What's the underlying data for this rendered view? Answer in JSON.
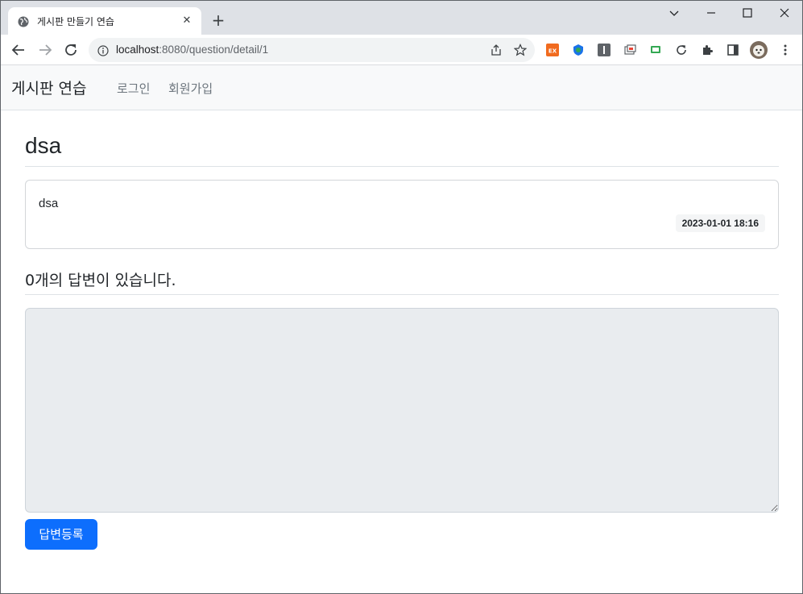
{
  "browser": {
    "tab_title": "게시판 만들기 연습",
    "tab_close": "✕",
    "new_tab": "+",
    "url_host": "localhost",
    "url_rest": ":8080/question/detail/1"
  },
  "navbar": {
    "brand": "게시판 연습",
    "links": [
      "로그인",
      "회원가입"
    ]
  },
  "question": {
    "subject": "dsa",
    "content": "dsa",
    "create_date": "2023-01-01 18:16"
  },
  "answers": {
    "count_text": "0개의 답변이 있습니다.",
    "textarea_value": "",
    "submit_label": "답변등록"
  },
  "colors": {
    "primary": "#0d6efd",
    "navbar_bg": "#f8f9fa",
    "textarea_bg": "#e9ecef"
  },
  "icons": {
    "favicon": "globe-icon",
    "back": "arrow-left-icon",
    "forward": "arrow-right-icon",
    "reload": "reload-icon",
    "info": "info-icon",
    "share": "share-icon",
    "bookmark": "star-icon"
  }
}
